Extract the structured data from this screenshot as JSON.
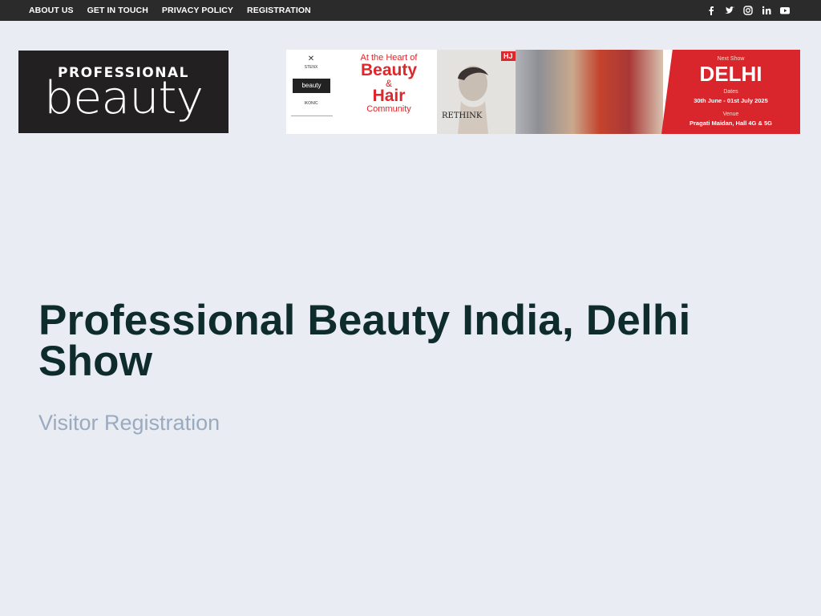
{
  "topnav": {
    "items": [
      {
        "label": "ABOUT US"
      },
      {
        "label": "GET IN TOUCH"
      },
      {
        "label": "PRIVACY POLICY"
      },
      {
        "label": "REGISTRATION"
      }
    ],
    "social_icons": [
      "facebook-icon",
      "twitter-icon",
      "instagram-icon",
      "linkedin-icon",
      "youtube-icon"
    ]
  },
  "logo": {
    "line1": "PROFESSIONAL",
    "line2": "beauty"
  },
  "banner": {
    "sponsor1": "STENX",
    "mini_logo": "beauty",
    "sponsor2": "IKONIC",
    "heart": "At the Heart of",
    "beauty": "Beauty",
    "amp": "&",
    "hair": "Hair",
    "community": "Community",
    "magazine_badge": "HJ",
    "magazine_title": "RETHINK",
    "next_show_label": "Next Show",
    "city": "DELHI",
    "dates_label": "Dates",
    "dates": "30th June - 01st July 2025",
    "venue_label": "Venue",
    "venue": "Pragati Maidan, Hall 4G & 5G"
  },
  "main": {
    "title": "Professional Beauty India, Delhi Show",
    "subtitle": "Visitor Registration"
  },
  "colors": {
    "topbar": "#2b2b2b",
    "background": "#e9ecf2",
    "title": "#0f2c2c",
    "subtitle": "#9aabc0",
    "accent_red": "#d9262c"
  }
}
